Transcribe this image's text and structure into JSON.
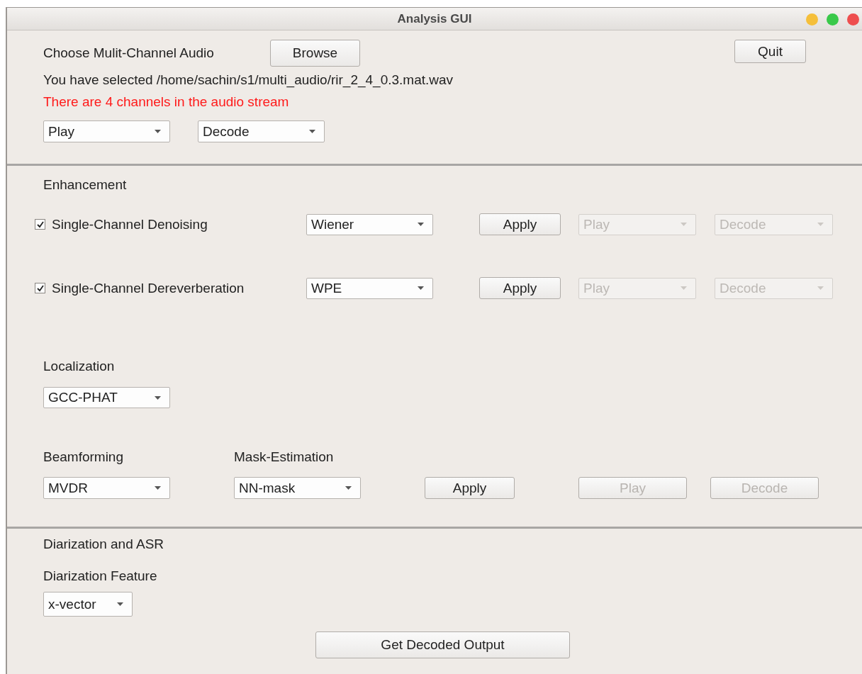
{
  "window": {
    "title": "Analysis GUI"
  },
  "input_section": {
    "label": "Choose Mulit-Channel Audio",
    "browse_button": "Browse",
    "quit_button": "Quit",
    "selected_text": "You have selected /home/sachin/s1/multi_audio/rir_2_4_0.3.mat.wav",
    "channel_message": "There are 4 channels in the audio stream",
    "dropdowns": [
      {
        "value": "Play",
        "disabled": false
      },
      {
        "value": "Decode",
        "disabled": false
      }
    ]
  },
  "enhancement": {
    "title": "Enhancement",
    "rows": [
      {
        "label": "Single-Channel Denoising",
        "checked": true,
        "method": {
          "value": "Wiener",
          "disabled": false
        },
        "apply": {
          "label": "Apply",
          "disabled": false
        },
        "play": {
          "value": "Play",
          "disabled": true
        },
        "decode": {
          "value": "Decode",
          "disabled": true
        }
      },
      {
        "label": "Single-Channel Dereverberation",
        "checked": true,
        "method": {
          "value": "WPE",
          "disabled": false
        },
        "apply": {
          "label": "Apply",
          "disabled": false
        },
        "play": {
          "value": "Play",
          "disabled": true
        },
        "decode": {
          "value": "Decode",
          "disabled": true
        }
      }
    ]
  },
  "localization": {
    "title": "Localization",
    "method": {
      "value": "GCC-PHAT",
      "disabled": false
    }
  },
  "beamforming": {
    "title": "Beamforming",
    "method": {
      "value": "MVDR",
      "disabled": false
    },
    "mask_title": "Mask-Estimation",
    "mask": {
      "value": "NN-mask",
      "disabled": false
    },
    "apply": {
      "label": "Apply",
      "disabled": false
    },
    "play": {
      "label": "Play",
      "disabled": true
    },
    "decode": {
      "label": "Decode",
      "disabled": true
    }
  },
  "diarization": {
    "title": "Diarization and ASR",
    "feature_label": "Diarization Feature",
    "feature": {
      "value": "x-vector",
      "disabled": false
    },
    "output_button": {
      "label": "Get Decoded Output",
      "disabled": false
    }
  }
}
